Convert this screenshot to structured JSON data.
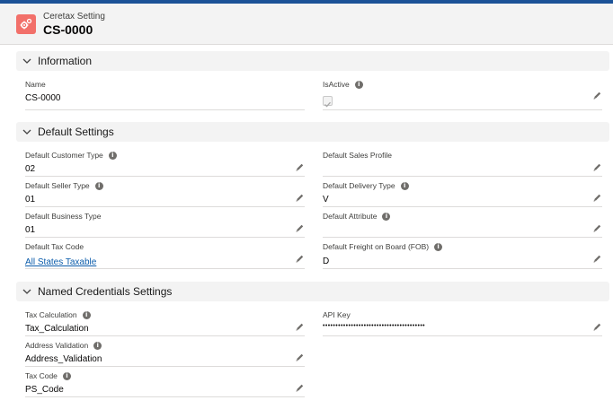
{
  "header": {
    "object_label": "Ceretax Setting",
    "record_name": "CS-0000"
  },
  "sections": {
    "information": "Information",
    "default_settings": "Default Settings",
    "named_credentials": "Named Credentials Settings"
  },
  "information": {
    "name": {
      "label": "Name",
      "value": "CS-0000"
    },
    "is_active": {
      "label": "IsActive",
      "checked": true
    }
  },
  "defaults": {
    "customer_type": {
      "label": "Default Customer Type",
      "value": "02"
    },
    "sales_profile": {
      "label": "Default Sales Profile",
      "value": ""
    },
    "seller_type": {
      "label": "Default Seller Type",
      "value": "01"
    },
    "delivery_type": {
      "label": "Default Delivery Type",
      "value": "V"
    },
    "business_type": {
      "label": "Default Business Type",
      "value": "01"
    },
    "attribute": {
      "label": "Default Attribute",
      "value": ""
    },
    "tax_code": {
      "label": "Default Tax Code",
      "value": "All States Taxable"
    },
    "fob": {
      "label": "Default Freight on Board (FOB)",
      "value": "D"
    }
  },
  "credentials": {
    "tax_calculation": {
      "label": "Tax Calculation",
      "value": "Tax_Calculation"
    },
    "api_key": {
      "label": "API Key",
      "value": "••••••••••••••••••••••••••••••••••••••••"
    },
    "address_validation": {
      "label": "Address Validation",
      "value": "Address_Validation"
    },
    "tax_code": {
      "label": "Tax Code",
      "value": "PS_Code"
    }
  },
  "icons": {
    "app": "settings-gears-icon",
    "section_toggle": "chevron-down-icon",
    "help": "info-icon",
    "edit": "pencil-icon",
    "checkbox_state": "check-icon"
  },
  "colors": {
    "accent_bar": "#1b5297",
    "app_icon_bg": "#f2706a",
    "link": "#0b5cab",
    "section_bg": "#f3f3f3"
  }
}
